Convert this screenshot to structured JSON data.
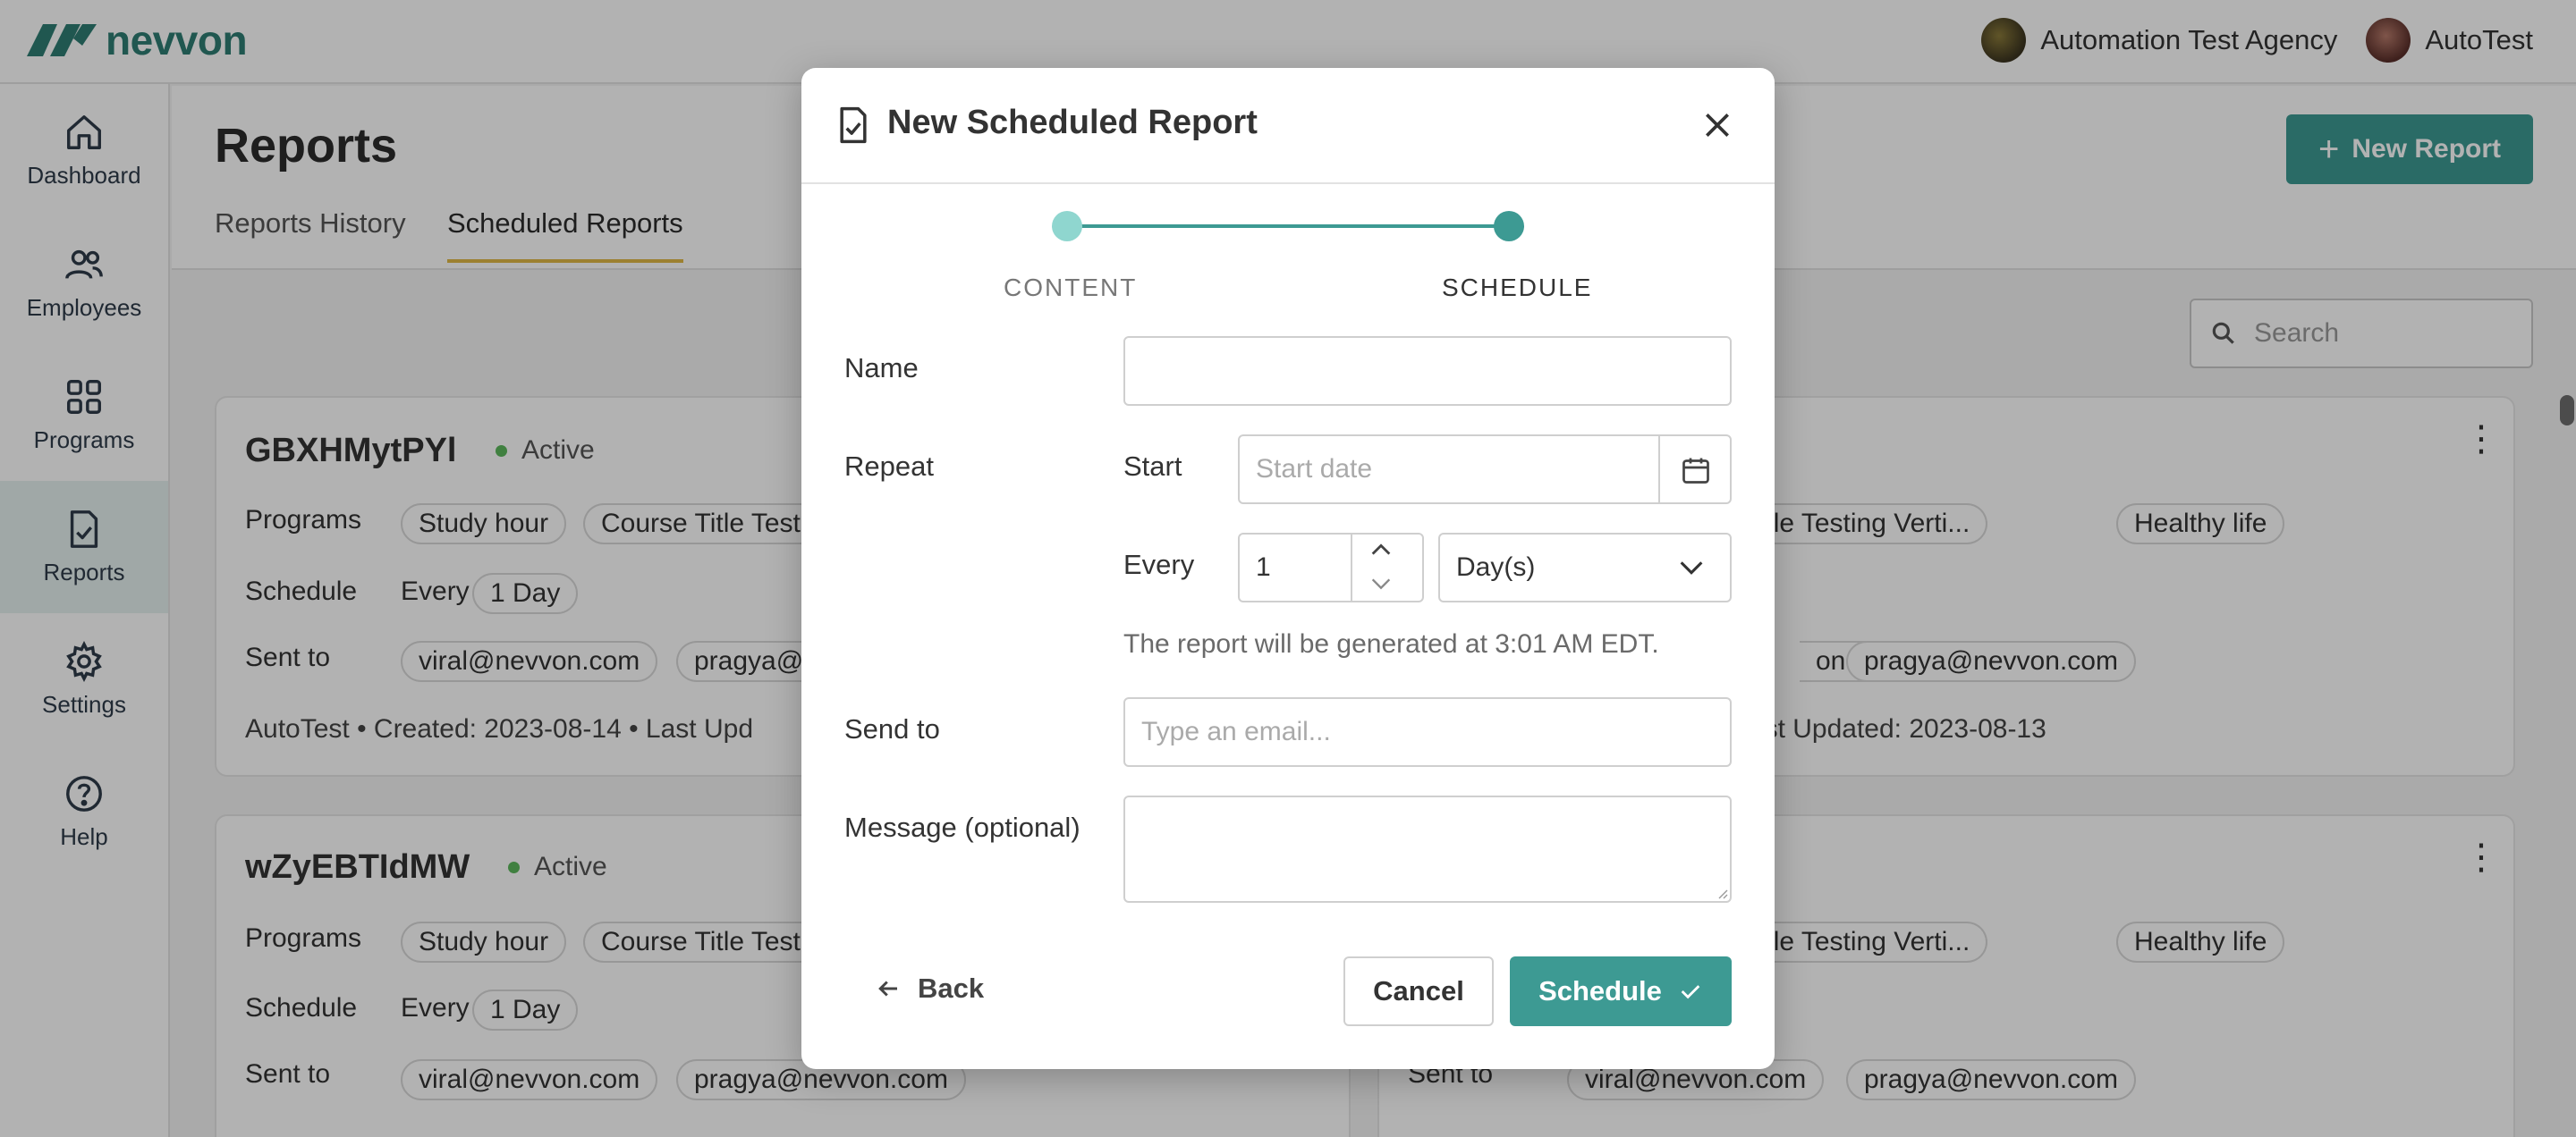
{
  "app": {
    "brand": "nevvon",
    "agency": "Automation Test Agency",
    "user": "AutoTest"
  },
  "sidebar": {
    "items": [
      {
        "label": "Dashboard",
        "icon": "home-icon"
      },
      {
        "label": "Employees",
        "icon": "users-icon"
      },
      {
        "label": "Programs",
        "icon": "grid-icon"
      },
      {
        "label": "Reports",
        "icon": "report-icon",
        "active": true
      },
      {
        "label": "Settings",
        "icon": "gear-icon"
      },
      {
        "label": "Help",
        "icon": "help-icon"
      }
    ]
  },
  "page": {
    "title": "Reports",
    "tabs": [
      {
        "label": "Reports History"
      },
      {
        "label": "Scheduled Reports",
        "active": true
      }
    ],
    "new_report_label": "New Report",
    "search_placeholder": "Search"
  },
  "cards": [
    {
      "title": "GBXHMytPYl",
      "status": "Active",
      "programs_label": "Programs",
      "programs": [
        "Study hour",
        "Course Title Test"
      ],
      "schedule_label": "Schedule",
      "schedule_prefix": "Every",
      "schedule_value": "1 Day",
      "sent_to_label": "Sent to",
      "recipients": [
        "viral@nevvon.com",
        "pragya@"
      ],
      "meta": "AutoTest  •  Created:  2023-08-14  •  Last Upd"
    },
    {
      "programs": [
        "Course Title Testing Verti...",
        "Healthy life"
      ],
      "recipients": [
        "on.com",
        "pragya@nevvon.com"
      ],
      "meta": "8-13  •  Last Updated:  2023-08-13"
    },
    {
      "title": "wZyEBTIdMW",
      "status": "Active",
      "programs_label": "Programs",
      "programs": [
        "Study hour",
        "Course Title Test"
      ],
      "schedule_label": "Schedule",
      "schedule_prefix": "Every",
      "schedule_value": "1 Day",
      "sent_to_label": "Sent to",
      "recipients": [
        "viral@nevvon.com",
        "pragya@nevvon.com"
      ]
    },
    {
      "programs": [
        "Course Title Testing Verti...",
        "Healthy life"
      ],
      "sent_to_label": "Sent to",
      "recipients": [
        "viral@nevvon.com",
        "pragya@nevvon.com"
      ]
    }
  ],
  "modal": {
    "title": "New Scheduled Report",
    "steps": [
      {
        "label": "CONTENT"
      },
      {
        "label": "SCHEDULE",
        "current": true
      }
    ],
    "name_label": "Name",
    "name_value": "",
    "repeat_label": "Repeat",
    "start_label": "Start",
    "start_placeholder": "Start date",
    "every_label": "Every",
    "every_value": "1",
    "unit_value": "Day(s)",
    "helper_text": "The report will be generated at 3:01 AM EDT.",
    "send_to_label": "Send to",
    "send_to_placeholder": "Type an email...",
    "message_label": "Message (optional)",
    "message_value": "",
    "back_label": "Back",
    "cancel_label": "Cancel",
    "schedule_label": "Schedule"
  },
  "colors": {
    "accent": "#3d9a93",
    "accent_light": "#8fd6cf",
    "tab_underline": "#e0b845",
    "status_active": "#5cb85c"
  }
}
